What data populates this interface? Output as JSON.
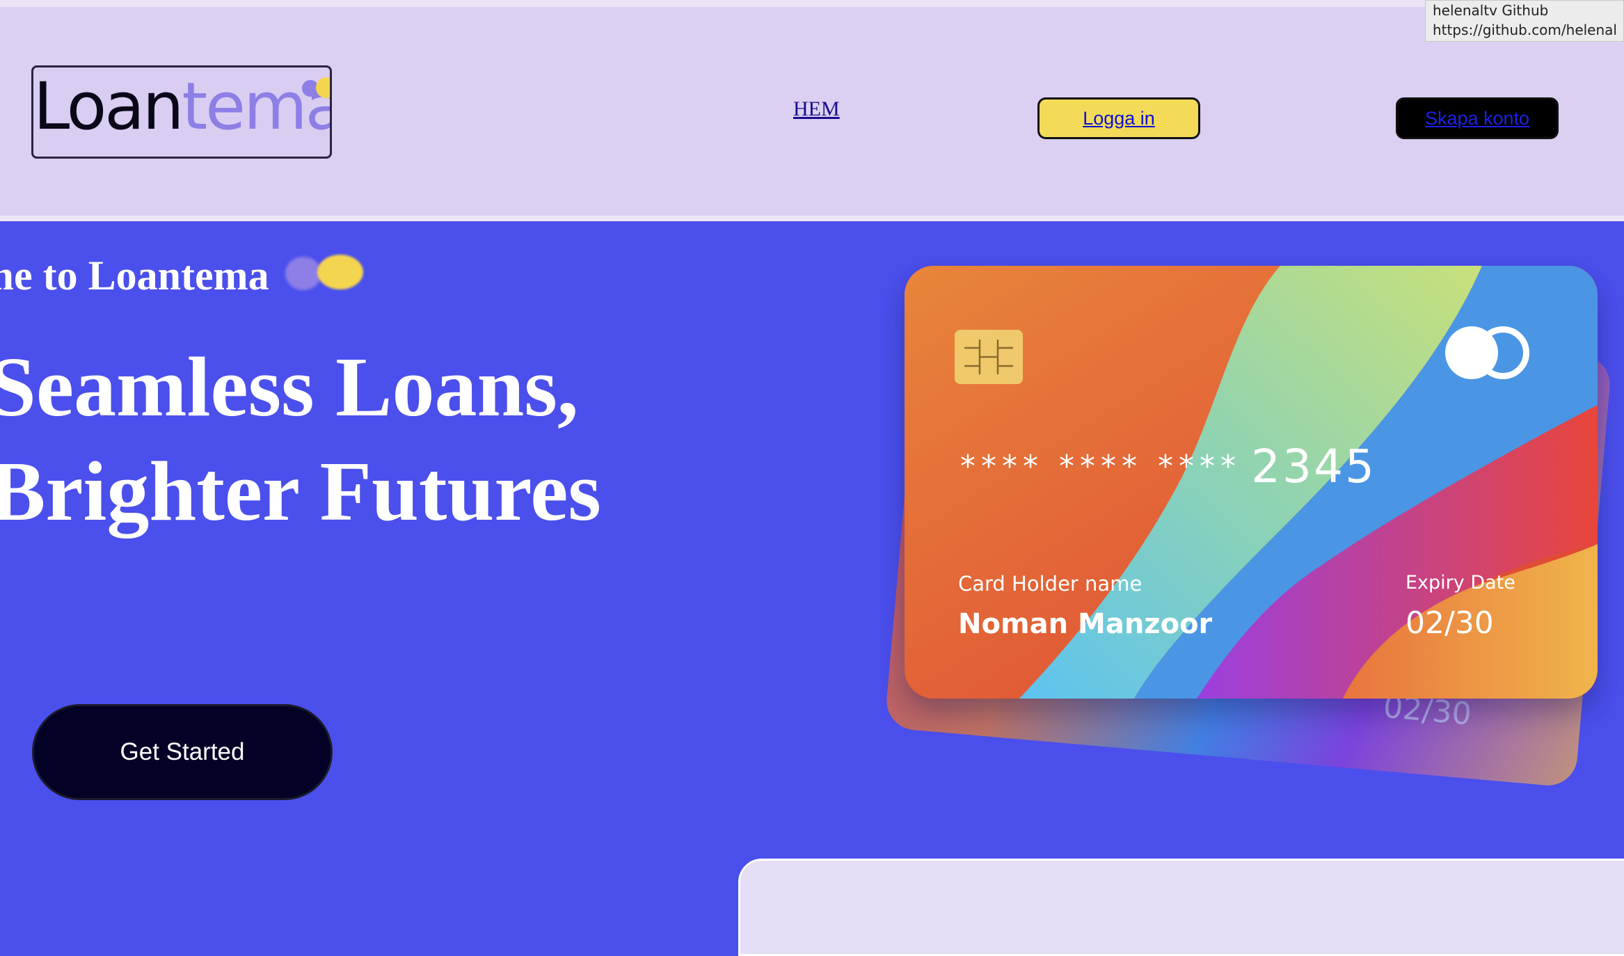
{
  "header": {
    "logo": {
      "part1": "Loan",
      "part2": "tema"
    },
    "nav": {
      "home": "HEM"
    },
    "login_label": "Logga in",
    "signup_label": "Skapa konto"
  },
  "tooltip": {
    "title": "helenaltv Github",
    "url": "https://github.com/helenal"
  },
  "hero": {
    "welcome": "me to Loantema",
    "headline_line1": "Seamless Loans,",
    "headline_line2": "Brighter Futures",
    "cta_label": "Get Started"
  },
  "card": {
    "number_masked": "**** **** ****",
    "number_last": "2345",
    "holder_label": "Card Holder name",
    "holder_name": "Noman Manzoor",
    "expiry_label": "Expiry Date",
    "expiry_value": "02/30",
    "back_expiry": "02/30"
  },
  "colors": {
    "hero_bg": "#4b4fec",
    "header_bg": "#dbd0f1",
    "login_bg": "#f3da58",
    "cta_bg": "#040126",
    "accent_yellow": "#f4d54f",
    "accent_purple": "#8d7fe6"
  }
}
